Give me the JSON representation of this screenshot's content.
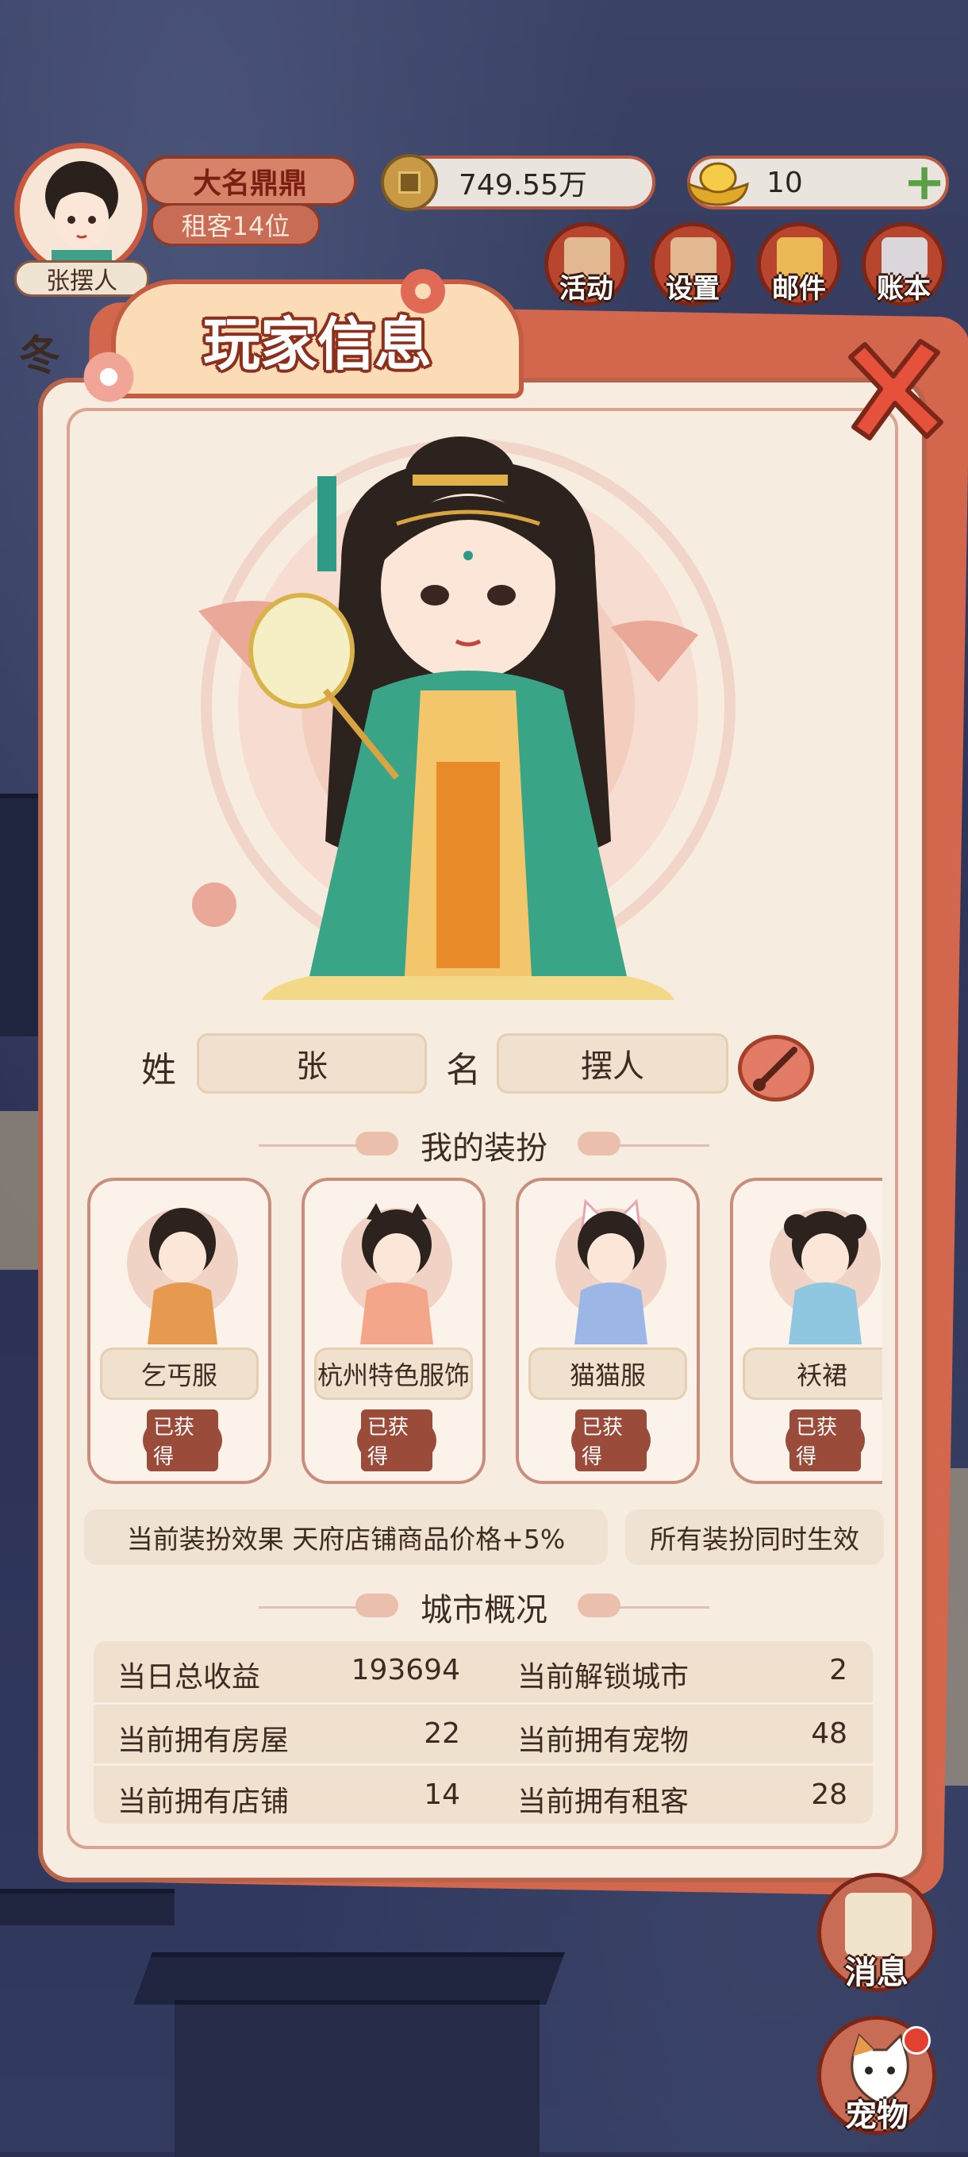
{
  "hud": {
    "player_nickname": "张摆人",
    "player_title": "大名鼎鼎",
    "player_rank": "租客14位",
    "copper_amount": "749.55万",
    "gold_amount": "10",
    "menu": [
      {
        "label": "活动",
        "icon": "activity-icon"
      },
      {
        "label": "设置",
        "icon": "settings-icon"
      },
      {
        "label": "邮件",
        "icon": "mail-icon"
      },
      {
        "label": "账本",
        "icon": "ledger-icon"
      }
    ],
    "side_buttons": [
      {
        "label": "消息",
        "icon": "message-icon"
      },
      {
        "label": "宠物",
        "icon": "pet-cat-icon"
      }
    ],
    "season_char": "冬"
  },
  "panel": {
    "title": "玩家信息",
    "surname_label": "姓",
    "surname_value": "张",
    "given_label": "名",
    "given_value": "摆人",
    "outfits_title": "我的装扮",
    "outfits": [
      {
        "name": "乞丐服",
        "status": "已获得"
      },
      {
        "name": "杭州特色服饰",
        "status": "已获得"
      },
      {
        "name": "猫猫服",
        "status": "已获得"
      },
      {
        "name": "袄裙",
        "status": "已获得"
      }
    ],
    "effect_text": "当前装扮效果 天府店铺商品价格+5%",
    "effect_note": "所有装扮同时生效",
    "city_title": "城市概况",
    "stats": [
      {
        "left_label": "当日总收益",
        "left_value": "193694",
        "right_label": "当前解锁城市",
        "right_value": "2"
      },
      {
        "left_label": "当前拥有房屋",
        "left_value": "22",
        "right_label": "当前拥有宠物",
        "right_value": "48"
      },
      {
        "left_label": "当前拥有店铺",
        "left_value": "14",
        "right_label": "当前拥有租客",
        "right_value": "28"
      }
    ]
  },
  "colors": {
    "panel_bg": "#f7ece0",
    "accent_red": "#c35c40",
    "text_dark": "#3b2b22"
  }
}
